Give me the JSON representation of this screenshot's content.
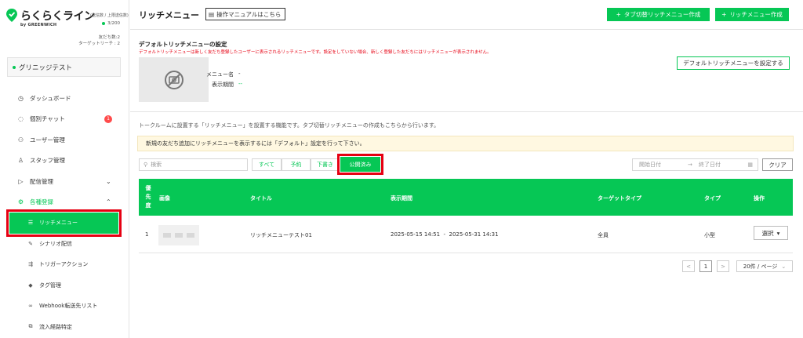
{
  "brand": {
    "name": "らくらくライン",
    "sub": "(送信数 / 上限送信数)",
    "by": "by GREENWICH",
    "send_count": "3/200",
    "friends": "友だち数:2",
    "targets": "ターゲットリーチ : 2"
  },
  "account": {
    "name": "グリニッジテスト"
  },
  "sidebar": {
    "items": [
      {
        "label": "ダッシュボード",
        "icon": "dashboard-icon"
      },
      {
        "label": "個別チャット",
        "icon": "chat-icon",
        "badge": "1"
      },
      {
        "label": "ユーザー管理",
        "icon": "users-icon"
      },
      {
        "label": "スタッフ管理",
        "icon": "staff-icon"
      },
      {
        "label": "配信管理",
        "icon": "send-icon"
      },
      {
        "label": "各種登録",
        "icon": "gear-icon"
      }
    ],
    "subitems": [
      {
        "label": "リッチメニュー",
        "icon": "menu-icon"
      },
      {
        "label": "シナリオ配信",
        "icon": "scenario-icon"
      },
      {
        "label": "トリガーアクション",
        "icon": "trigger-icon"
      },
      {
        "label": "タグ管理",
        "icon": "tag-icon"
      },
      {
        "label": "Webhook転送先リスト",
        "icon": "link-icon"
      },
      {
        "label": "流入経路特定",
        "icon": "route-icon"
      }
    ]
  },
  "header": {
    "title": "リッチメニュー",
    "manual": "操作マニュアルはこちら",
    "btn_tab_rich": "タブ切替リッチメニュー作成",
    "btn_rich": "リッチメニュー作成"
  },
  "default_menu": {
    "title": "デフォルトリッチメニューの設定",
    "note": "デフォルトリッチメニューは新しく友だち登録したユーザーに表示されるリッチメニューです。設定をしていない場合、新しく登録した友だちにはリッチメニューが表示されません。",
    "menu_name_label": "メニュー名",
    "menu_name_value": "-",
    "period_label": "表示期間",
    "period_value": "--",
    "set_button": "デフォルトリッチメニューを設定する"
  },
  "list": {
    "description": "トークルームに設置する「リッチメニュー」を設置する機能です。タブ切替リッチメニューの作成もこちらから行います。",
    "notice": "新規の友だち追加にリッチメニューを表示するには「デフォルト」設定を行って下さい。",
    "search_placeholder": "検索",
    "filters": [
      "すべて",
      "予約",
      "下書き",
      "公開済み"
    ],
    "start_date": "開始日付",
    "end_date": "終了日付",
    "arrow": "→",
    "clear": "クリア"
  },
  "table": {
    "headers": {
      "priority": "優先度",
      "image": "画像",
      "title": "タイトル",
      "period": "表示期間",
      "target": "ターゲットタイプ",
      "type": "タイプ",
      "action": "操作"
    },
    "rows": [
      {
        "priority": "1",
        "title": "リッチメニューテスト01",
        "period": "2025-05-15 14:51  -  2025-05-31 14:31",
        "target": "全員",
        "type": "小型",
        "action": "選択"
      }
    ]
  },
  "pagination": {
    "prev": "<",
    "page": "1",
    "next": ">",
    "per_page": "20件 / ページ"
  },
  "colors": {
    "accent": "#06c755",
    "highlight": "#e60012",
    "badge": "#ff4b4b"
  }
}
